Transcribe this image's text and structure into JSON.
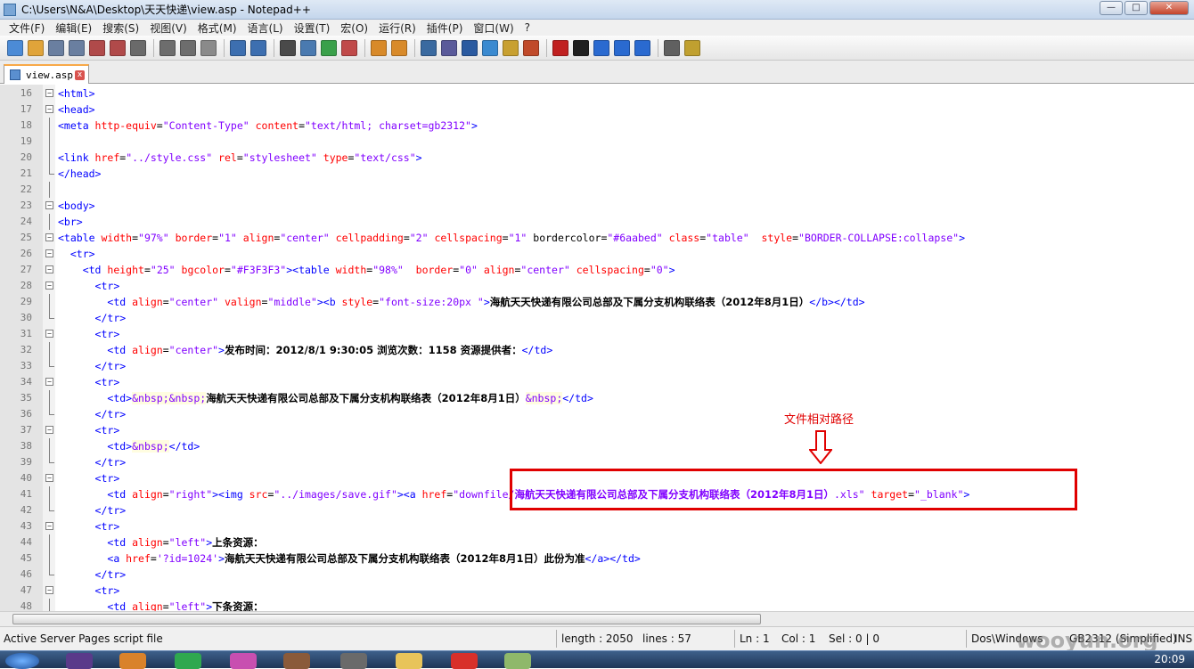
{
  "window": {
    "title": "C:\\Users\\N&A\\Desktop\\天天快递\\view.asp - Notepad++",
    "minimize": "—",
    "maximize": "□",
    "close": "✕"
  },
  "menu": [
    "文件(F)",
    "编辑(E)",
    "搜索(S)",
    "视图(V)",
    "格式(M)",
    "语言(L)",
    "设置(T)",
    "宏(O)",
    "运行(R)",
    "插件(P)",
    "窗口(W)",
    "?"
  ],
  "toolbar": {
    "icons": [
      "new-file-icon",
      "open-file-icon",
      "save-icon",
      "save-all-icon",
      "close-icon",
      "close-all-icon",
      "print-icon",
      "cut-icon",
      "copy-icon",
      "paste-icon",
      "undo-icon",
      "redo-icon",
      "find-icon",
      "replace-icon",
      "zoom-in-icon",
      "zoom-out-icon",
      "sync-v-icon",
      "sync-h-icon",
      "wrap-icon",
      "show-all-chars-icon",
      "indent-guide-icon",
      "user-lang-icon",
      "doc-map-icon",
      "function-list-icon",
      "record-macro-icon",
      "stop-record-icon",
      "play-macro-icon",
      "run-macro-multiple-icon",
      "save-macro-icon",
      "spellcheck-icon",
      "plugin-icon"
    ]
  },
  "tab": {
    "label": "view.asp",
    "close": "x"
  },
  "editor": {
    "lines": [
      {
        "n": "16",
        "fold": "box",
        "tokens": [
          [
            "t",
            "<html>"
          ]
        ]
      },
      {
        "n": "17",
        "fold": "box",
        "tokens": [
          [
            "t",
            "<head>"
          ]
        ]
      },
      {
        "n": "18",
        "fold": "line",
        "tokens": [
          [
            "t",
            "<meta "
          ],
          [
            "a",
            "http-equiv"
          ],
          [
            "z",
            "="
          ],
          [
            "v",
            "\"Content-Type\""
          ],
          [
            "a",
            " content"
          ],
          [
            "z",
            "="
          ],
          [
            "v",
            "\"text/html; charset=gb2312\""
          ],
          [
            "t",
            ">"
          ]
        ]
      },
      {
        "n": "19",
        "fold": "line",
        "tokens": []
      },
      {
        "n": "20",
        "fold": "line",
        "tokens": [
          [
            "t",
            "<link "
          ],
          [
            "a",
            "href"
          ],
          [
            "z",
            "="
          ],
          [
            "v",
            "\"../style.css\""
          ],
          [
            "a",
            " rel"
          ],
          [
            "z",
            "="
          ],
          [
            "v",
            "\"stylesheet\""
          ],
          [
            "a",
            " type"
          ],
          [
            "z",
            "="
          ],
          [
            "v",
            "\"text/css\""
          ],
          [
            "t",
            ">"
          ]
        ]
      },
      {
        "n": "21",
        "fold": "end",
        "tokens": [
          [
            "t",
            "</head>"
          ]
        ]
      },
      {
        "n": "22",
        "fold": "line",
        "tokens": []
      },
      {
        "n": "23",
        "fold": "box",
        "tokens": [
          [
            "t",
            "<body>"
          ]
        ]
      },
      {
        "n": "24",
        "fold": "line",
        "tokens": [
          [
            "t",
            "<br>"
          ]
        ]
      },
      {
        "n": "25",
        "fold": "box",
        "tokens": [
          [
            "t",
            "<table "
          ],
          [
            "a",
            "width"
          ],
          [
            "z",
            "="
          ],
          [
            "v",
            "\"97%\""
          ],
          [
            "a",
            " border"
          ],
          [
            "z",
            "="
          ],
          [
            "v",
            "\"1\""
          ],
          [
            "a",
            " align"
          ],
          [
            "z",
            "="
          ],
          [
            "v",
            "\"center\""
          ],
          [
            "a",
            " cellpadding"
          ],
          [
            "z",
            "="
          ],
          [
            "v",
            "\"2\""
          ],
          [
            "a",
            " cellspacing"
          ],
          [
            "z",
            "="
          ],
          [
            "v",
            "\"1\""
          ],
          [
            "z",
            " bordercolor"
          ],
          [
            "z",
            "="
          ],
          [
            "v",
            "\"#6aabed\""
          ],
          [
            "a",
            " class"
          ],
          [
            "z",
            "="
          ],
          [
            "v",
            "\"table\""
          ],
          [
            "a",
            "  style"
          ],
          [
            "z",
            "="
          ],
          [
            "v",
            "\"BORDER-COLLAPSE:collapse\""
          ],
          [
            "t",
            ">"
          ]
        ]
      },
      {
        "n": "26",
        "fold": "box",
        "tokens": [
          [
            "z",
            "  "
          ],
          [
            "t",
            "<tr>"
          ]
        ]
      },
      {
        "n": "27",
        "fold": "box",
        "tokens": [
          [
            "z",
            "    "
          ],
          [
            "t",
            "<td "
          ],
          [
            "a",
            "height"
          ],
          [
            "z",
            "="
          ],
          [
            "v",
            "\"25\""
          ],
          [
            "a",
            " bgcolor"
          ],
          [
            "z",
            "="
          ],
          [
            "v",
            "\"#F3F3F3\""
          ],
          [
            "t",
            "><table "
          ],
          [
            "a",
            "width"
          ],
          [
            "z",
            "="
          ],
          [
            "v",
            "\"98%\""
          ],
          [
            "a",
            "  border"
          ],
          [
            "z",
            "="
          ],
          [
            "v",
            "\"0\""
          ],
          [
            "a",
            " align"
          ],
          [
            "z",
            "="
          ],
          [
            "v",
            "\"center\""
          ],
          [
            "a",
            " cellspacing"
          ],
          [
            "z",
            "="
          ],
          [
            "v",
            "\"0\""
          ],
          [
            "t",
            ">"
          ]
        ]
      },
      {
        "n": "28",
        "fold": "box",
        "tokens": [
          [
            "z",
            "      "
          ],
          [
            "t",
            "<tr>"
          ]
        ]
      },
      {
        "n": "29",
        "fold": "line",
        "tokens": [
          [
            "z",
            "        "
          ],
          [
            "t",
            "<td "
          ],
          [
            "a",
            "align"
          ],
          [
            "z",
            "="
          ],
          [
            "v",
            "\"center\""
          ],
          [
            "a",
            " valign"
          ],
          [
            "z",
            "="
          ],
          [
            "v",
            "\"middle\""
          ],
          [
            "t",
            "><b "
          ],
          [
            "a",
            "style"
          ],
          [
            "z",
            "="
          ],
          [
            "v",
            "\"font-size:20px \""
          ],
          [
            "t",
            ">"
          ],
          [
            "c",
            "海航天天快递有限公司总部及下属分支机构联络表（2012年8月1日）"
          ],
          [
            "t",
            "</b></td>"
          ]
        ]
      },
      {
        "n": "30",
        "fold": "end",
        "tokens": [
          [
            "z",
            "      "
          ],
          [
            "t",
            "</tr>"
          ]
        ]
      },
      {
        "n": "31",
        "fold": "box",
        "tokens": [
          [
            "z",
            "      "
          ],
          [
            "t",
            "<tr>"
          ]
        ]
      },
      {
        "n": "32",
        "fold": "line",
        "tokens": [
          [
            "z",
            "        "
          ],
          [
            "t",
            "<td "
          ],
          [
            "a",
            "align"
          ],
          [
            "z",
            "="
          ],
          [
            "v",
            "\"center\""
          ],
          [
            "t",
            ">"
          ],
          [
            "c",
            "发布时间：2012/8/1 9:30:05 浏览次数：1158 资源提供者："
          ],
          [
            "t",
            "</td>"
          ]
        ]
      },
      {
        "n": "33",
        "fold": "end",
        "tokens": [
          [
            "z",
            "      "
          ],
          [
            "t",
            "</tr>"
          ]
        ]
      },
      {
        "n": "34",
        "fold": "box",
        "tokens": [
          [
            "z",
            "      "
          ],
          [
            "t",
            "<tr>"
          ]
        ]
      },
      {
        "n": "35",
        "fold": "line",
        "tokens": [
          [
            "z",
            "        "
          ],
          [
            "t",
            "<td>"
          ],
          [
            "e",
            "&nbsp;&nbsp;"
          ],
          [
            "c",
            "海航天天快递有限公司总部及下属分支机构联络表（2012年8月1日）"
          ],
          [
            "e",
            "&nbsp;"
          ],
          [
            "t",
            "</td>"
          ]
        ]
      },
      {
        "n": "36",
        "fold": "end",
        "tokens": [
          [
            "z",
            "      "
          ],
          [
            "t",
            "</tr>"
          ]
        ]
      },
      {
        "n": "37",
        "fold": "box",
        "tokens": [
          [
            "z",
            "      "
          ],
          [
            "t",
            "<tr>"
          ]
        ]
      },
      {
        "n": "38",
        "fold": "line",
        "tokens": [
          [
            "z",
            "        "
          ],
          [
            "t",
            "<td>"
          ],
          [
            "e",
            "&nbsp;"
          ],
          [
            "t",
            "</td>"
          ]
        ]
      },
      {
        "n": "39",
        "fold": "end",
        "tokens": [
          [
            "z",
            "      "
          ],
          [
            "t",
            "</tr>"
          ]
        ]
      },
      {
        "n": "40",
        "fold": "box",
        "tokens": [
          [
            "z",
            "      "
          ],
          [
            "t",
            "<tr>"
          ]
        ]
      },
      {
        "n": "41",
        "fold": "line",
        "tokens": [
          [
            "z",
            "        "
          ],
          [
            "t",
            "<td "
          ],
          [
            "a",
            "align"
          ],
          [
            "z",
            "="
          ],
          [
            "v",
            "\"right\""
          ],
          [
            "t",
            "><img "
          ],
          [
            "a",
            "src"
          ],
          [
            "z",
            "="
          ],
          [
            "v",
            "\"../images/save.gif\""
          ],
          [
            "t",
            "><a "
          ],
          [
            "a",
            "href"
          ],
          [
            "z",
            "="
          ],
          [
            "v",
            "\"downfile/"
          ],
          [
            "cv",
            "海航天天快递有限公司总部及下属分支机构联络表（2012年8月1日）"
          ],
          [
            "v",
            ".xls\""
          ],
          [
            "a",
            " target"
          ],
          [
            "z",
            "="
          ],
          [
            "v",
            "\"_blank\""
          ],
          [
            "t",
            ">"
          ]
        ]
      },
      {
        "n": "42",
        "fold": "end",
        "tokens": [
          [
            "z",
            "      "
          ],
          [
            "t",
            "</tr>"
          ]
        ]
      },
      {
        "n": "43",
        "fold": "box",
        "tokens": [
          [
            "z",
            "      "
          ],
          [
            "t",
            "<tr>"
          ]
        ]
      },
      {
        "n": "44",
        "fold": "line",
        "tokens": [
          [
            "z",
            "        "
          ],
          [
            "t",
            "<td "
          ],
          [
            "a",
            "align"
          ],
          [
            "z",
            "="
          ],
          [
            "v",
            "\"left\""
          ],
          [
            "t",
            ">"
          ],
          [
            "c",
            "上条资源："
          ]
        ]
      },
      {
        "n": "45",
        "fold": "line",
        "tokens": [
          [
            "z",
            "        "
          ],
          [
            "t",
            "<a "
          ],
          [
            "a",
            "href"
          ],
          [
            "z",
            "="
          ],
          [
            "v",
            "'?id=1024'"
          ],
          [
            "t",
            ">"
          ],
          [
            "c",
            "海航天天快递有限公司总部及下属分支机构联络表（2012年8月1日）此份为准"
          ],
          [
            "t",
            "</a></td>"
          ]
        ]
      },
      {
        "n": "46",
        "fold": "end",
        "tokens": [
          [
            "z",
            "      "
          ],
          [
            "t",
            "</tr>"
          ]
        ]
      },
      {
        "n": "47",
        "fold": "box",
        "tokens": [
          [
            "z",
            "      "
          ],
          [
            "t",
            "<tr>"
          ]
        ]
      },
      {
        "n": "48",
        "fold": "line",
        "tokens": [
          [
            "z",
            "        "
          ],
          [
            "t",
            "<td "
          ],
          [
            "a",
            "align"
          ],
          [
            "z",
            "="
          ],
          [
            "v",
            "\"left\""
          ],
          [
            "t",
            ">"
          ],
          [
            "c",
            "下条资源："
          ]
        ]
      }
    ]
  },
  "annotation": {
    "label": "文件相对路径"
  },
  "status": {
    "filetype": "Active Server Pages script file",
    "length": "length : 2050",
    "lines": "lines : 57",
    "ln": "Ln : 1",
    "col": "Col : 1",
    "sel": "Sel : 0 | 0",
    "eol": "Dos\\Windows",
    "encoding": "GB2312 (Simplified)",
    "mode": "INS"
  },
  "watermark": "wooyun.org",
  "taskbar": {
    "clock": "20:09"
  },
  "colors": {
    "tag": "#0000ff",
    "attr": "#ff0000",
    "value": "#8000ff",
    "annotation": "#e00000"
  }
}
